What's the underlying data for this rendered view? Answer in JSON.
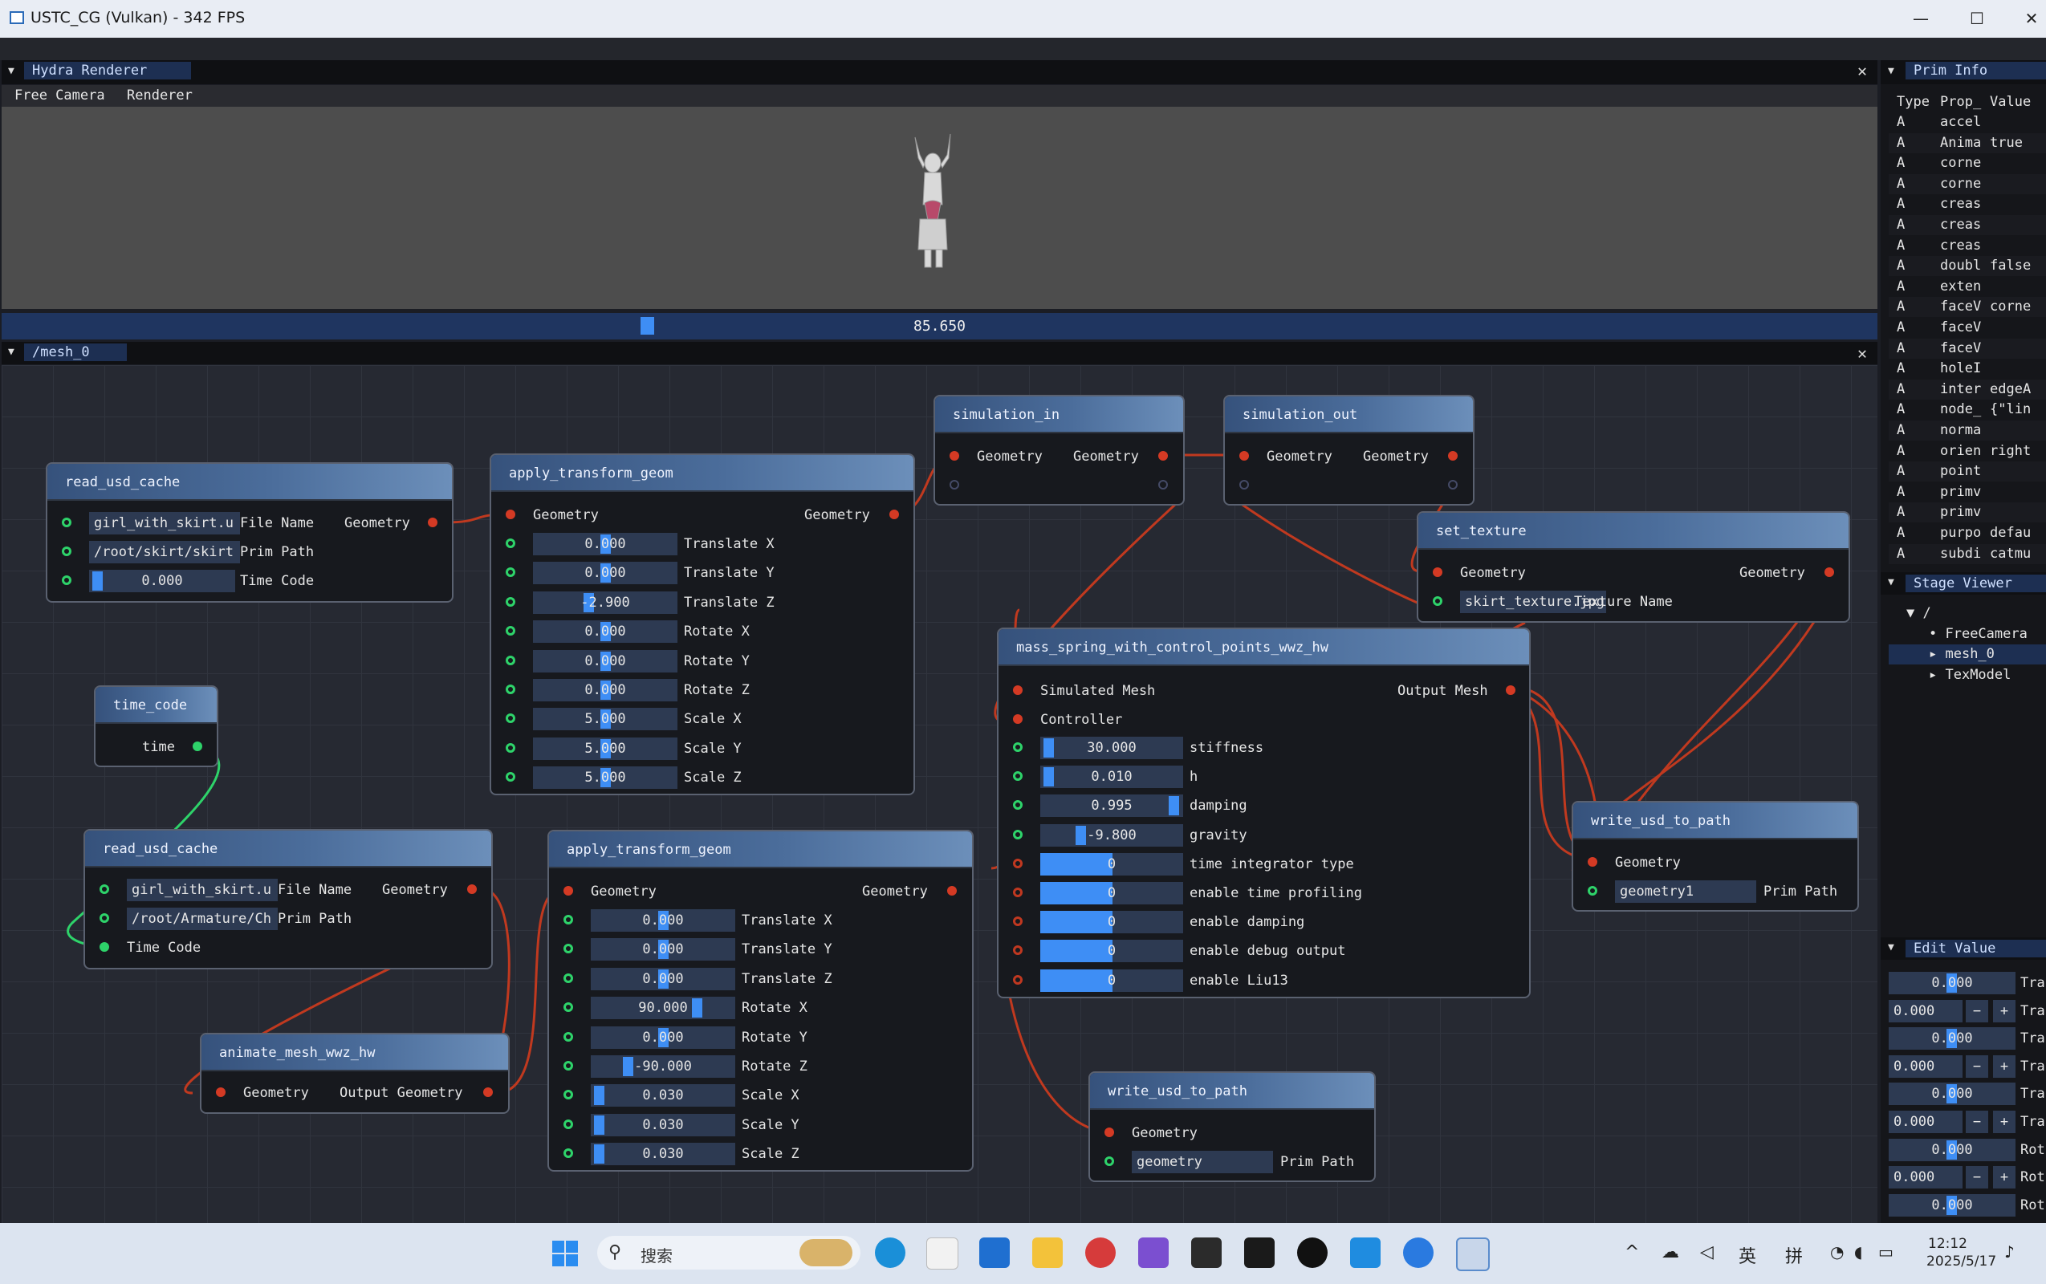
{
  "window": {
    "title": "USTC_CG (Vulkan) - 342 FPS",
    "minimize": "—",
    "maximize": "☐",
    "close": "✕"
  },
  "hydra": {
    "tab": "Hydra Renderer",
    "menu": [
      "Free Camera",
      "Renderer"
    ],
    "timeline_value": "85.650",
    "close": "✕"
  },
  "editor": {
    "tab": "/mesh_0",
    "close": "✕"
  },
  "nodes": {
    "rc1": {
      "title": "read_usd_cache",
      "file": "girl_with_skirt.u",
      "file_label": "File Name",
      "out": "Geometry",
      "prim": "/root/skirt/skirt",
      "prim_label": "Prim Path",
      "time": "0.000",
      "time_label": "Time Code"
    },
    "tc": {
      "title": "time_code",
      "out": "time"
    },
    "rc2": {
      "title": "read_usd_cache",
      "file": "girl_with_skirt.u",
      "file_label": "File Name",
      "out": "Geometry",
      "prim": "/root/Armature/Ch",
      "prim_label": "Prim Path",
      "time_label": "Time Code"
    },
    "anim": {
      "title": "animate_mesh_wwz_hw",
      "in": "Geometry",
      "out": "Output Geometry"
    },
    "at1": {
      "title": "apply_transform_geom",
      "in": "Geometry",
      "out": "Geometry",
      "rows": [
        {
          "value": "0.000",
          "label": "Translate X"
        },
        {
          "value": "0.000",
          "label": "Translate Y"
        },
        {
          "value": "-2.900",
          "label": "Translate Z"
        },
        {
          "value": "0.000",
          "label": "Rotate X"
        },
        {
          "value": "0.000",
          "label": "Rotate Y"
        },
        {
          "value": "0.000",
          "label": "Rotate Z"
        },
        {
          "value": "5.000",
          "label": "Scale X"
        },
        {
          "value": "5.000",
          "label": "Scale Y"
        },
        {
          "value": "5.000",
          "label": "Scale Z"
        }
      ]
    },
    "at2": {
      "title": "apply_transform_geom",
      "in": "Geometry",
      "out": "Geometry",
      "rows": [
        {
          "value": "0.000",
          "label": "Translate X"
        },
        {
          "value": "0.000",
          "label": "Translate Y"
        },
        {
          "value": "0.000",
          "label": "Translate Z"
        },
        {
          "value": "90.000",
          "label": "Rotate X"
        },
        {
          "value": "0.000",
          "label": "Rotate Y"
        },
        {
          "value": "-90.000",
          "label": "Rotate Z"
        },
        {
          "value": "0.030",
          "label": "Scale X"
        },
        {
          "value": "0.030",
          "label": "Scale Y"
        },
        {
          "value": "0.030",
          "label": "Scale Z"
        }
      ]
    },
    "simin": {
      "title": "simulation_in",
      "in": "Geometry",
      "out": "Geometry"
    },
    "simout": {
      "title": "simulation_out",
      "in": "Geometry",
      "out": "Geometry"
    },
    "settex": {
      "title": "set_texture",
      "in": "Geometry",
      "out": "Geometry",
      "tex": "skirt_texture.jpg",
      "tex_label": "Texture Name"
    },
    "ms": {
      "title": "mass_spring_with_control_points_wwz_hw",
      "in1": "Simulated Mesh",
      "out": "Output Mesh",
      "in2": "Controller",
      "rows": [
        {
          "value": "30.000",
          "label": "stiffness"
        },
        {
          "value": "0.010",
          "label": "h"
        },
        {
          "value": "0.995",
          "label": "damping"
        },
        {
          "value": "-9.800",
          "label": "gravity"
        },
        {
          "value": "0",
          "label": "time integrator type"
        },
        {
          "value": "0",
          "label": "enable time profiling"
        },
        {
          "value": "0",
          "label": "enable damping"
        },
        {
          "value": "0",
          "label": "enable debug output"
        },
        {
          "value": "0",
          "label": "enable Liu13"
        }
      ]
    },
    "wu1": {
      "title": "write_usd_to_path",
      "in": "Geometry",
      "prim": "geometry1",
      "prim_label": "Prim Path"
    },
    "wu2": {
      "title": "write_usd_to_path",
      "in": "Geometry",
      "prim": "geometry",
      "prim_label": "Prim Path"
    }
  },
  "prim_info": {
    "tab": "Prim Info",
    "headers": [
      "Type",
      "Prop_",
      "Value"
    ],
    "rows": [
      [
        "A",
        "accel",
        ""
      ],
      [
        "A",
        "Anima",
        "true"
      ],
      [
        "A",
        "corne",
        ""
      ],
      [
        "A",
        "corne",
        ""
      ],
      [
        "A",
        "creas",
        ""
      ],
      [
        "A",
        "creas",
        ""
      ],
      [
        "A",
        "creas",
        ""
      ],
      [
        "A",
        "doubl",
        "false"
      ],
      [
        "A",
        "exten",
        ""
      ],
      [
        "A",
        "faceV",
        "corne"
      ],
      [
        "A",
        "faceV",
        ""
      ],
      [
        "A",
        "faceV",
        ""
      ],
      [
        "A",
        "holeI",
        ""
      ],
      [
        "A",
        "inter",
        "edgeA"
      ],
      [
        "A",
        "node_",
        "{\"lin"
      ],
      [
        "A",
        "norma",
        ""
      ],
      [
        "A",
        "orien",
        "right"
      ],
      [
        "A",
        "point",
        ""
      ],
      [
        "A",
        "primv",
        ""
      ],
      [
        "A",
        "primv",
        ""
      ],
      [
        "A",
        "purpo",
        "defau"
      ],
      [
        "A",
        "subdi",
        "catmu"
      ]
    ]
  },
  "stage_viewer": {
    "tab": "Stage Viewer",
    "root": "/",
    "items": [
      "FreeCamera",
      "mesh_0",
      "TexModel"
    ]
  },
  "edit_value": {
    "tab": "Edit Value",
    "rows": [
      {
        "value": "0.000",
        "label": "Trar"
      },
      {
        "value": "0.000",
        "label": "Trar",
        "stepper": true
      },
      {
        "value": "0.000",
        "label": "Trar"
      },
      {
        "value": "0.000",
        "label": "Trar",
        "stepper": true
      },
      {
        "value": "0.000",
        "label": "Trar"
      },
      {
        "value": "0.000",
        "label": "Trar",
        "stepper": true
      },
      {
        "value": "0.000",
        "label": "Rot"
      },
      {
        "value": "0.000",
        "label": "Rot",
        "stepper": true
      },
      {
        "value": "0.000",
        "label": "Rot"
      }
    ],
    "minus": "−",
    "plus": "+"
  },
  "taskbar": {
    "search_placeholder": "搜索",
    "tray_ime1": "英",
    "tray_ime2": "拼",
    "time": "12:12",
    "date": "2025/5/17",
    "accent": "#3e8ef5"
  }
}
